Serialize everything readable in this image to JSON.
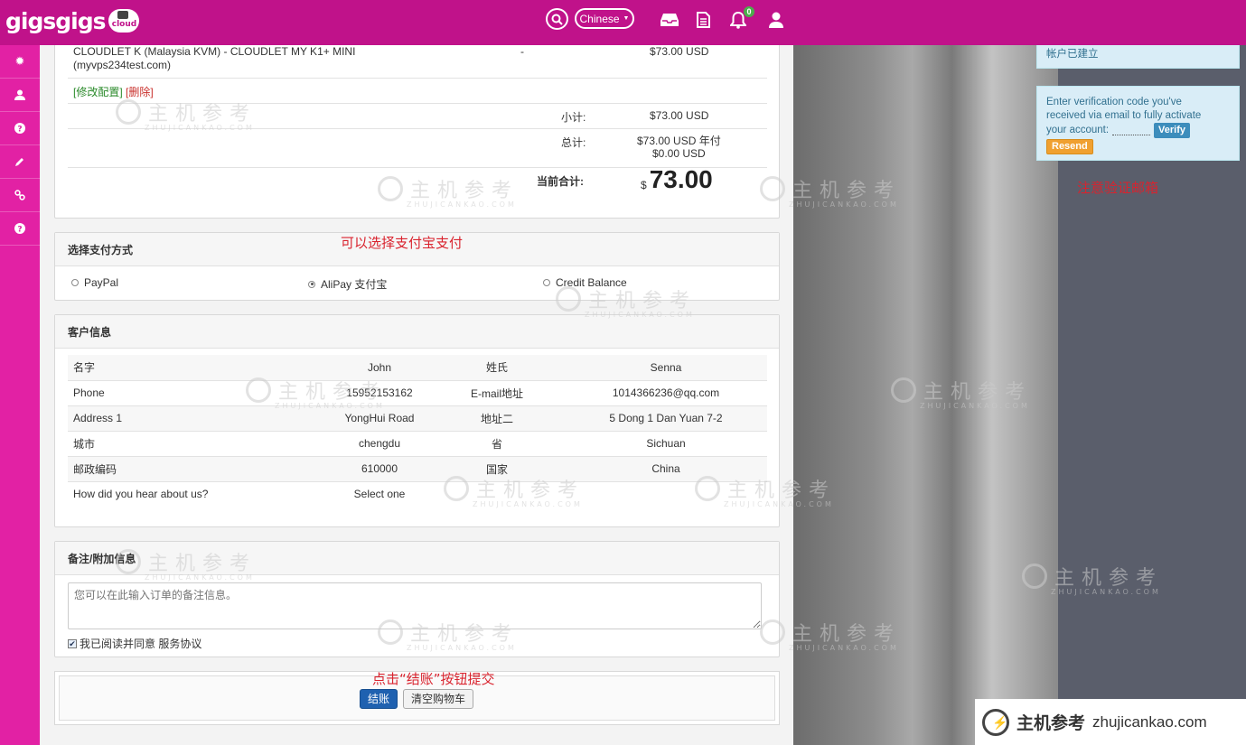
{
  "header": {
    "logo_text": "gigsgigs",
    "logo_badge": "cloud",
    "language_label": "Chinese",
    "notification_count": "0"
  },
  "cart_item": {
    "name_line1": "CLOUDLET K (Malaysia KVM) - CLOUDLET MY K1+ MINI",
    "name_line2": "(myvps234test.com)",
    "dash": "-",
    "price": "$73.00 USD",
    "modify_label": "[修改配置]",
    "delete_label": "[删除]"
  },
  "totals": {
    "subtotal_label": "小计:",
    "subtotal_value": "$73.00 USD",
    "total_label": "总计:",
    "total_value1": "$73.00 USD 年付",
    "total_value2": "$0.00 USD",
    "current_label": "当前合计:",
    "current_currency": "$",
    "current_amount": "73.00"
  },
  "payment": {
    "title": "选择支付方式",
    "annotation": "可以选择支付宝支付",
    "options": [
      {
        "label": "PayPal",
        "selected": false
      },
      {
        "label": "AliPay 支付宝",
        "selected": true
      },
      {
        "label": "Credit Balance",
        "selected": false
      }
    ]
  },
  "customer": {
    "title": "客户信息",
    "rows": [
      [
        "名字",
        "John",
        "姓氏",
        "Senna"
      ],
      [
        "Phone",
        "15952153162",
        "E-mail地址",
        "1014366236@qq.com"
      ],
      [
        "Address 1",
        "YongHui Road",
        "地址二",
        "5 Dong 1 Dan Yuan 7-2"
      ],
      [
        "城市",
        "chengdu",
        "省",
        "Sichuan"
      ],
      [
        "邮政编码",
        "610000",
        "国家",
        "China"
      ],
      [
        "How did you hear about us?",
        "Select one",
        "",
        ""
      ]
    ]
  },
  "notes": {
    "title": "备注/附加信息",
    "placeholder": "您可以在此输入订单的备注信息。",
    "agree_text": "我已阅读并同意 服务协议"
  },
  "checkout": {
    "annotation": "点击“结账”按钮提交",
    "checkout_label": "结账",
    "clear_label": "清空购物车"
  },
  "alerts": {
    "account_created": "帐户已建立",
    "verify_text1": "Enter verification code you've",
    "verify_text2": "received via email to fully activate",
    "verify_text3": "your account:",
    "verify_button": "Verify",
    "resend_button": "Resend",
    "annotation": "注意验证邮箱"
  },
  "watermark": {
    "brand": "主机参考",
    "domain": "ZHUJICANKAO.COM",
    "footer_brand": "主机参考",
    "footer_domain": "zhujicankao.com"
  },
  "colors": {
    "topbar": "#c0128a",
    "sidebar": "#e221a4",
    "annotation": "#d9232e"
  }
}
